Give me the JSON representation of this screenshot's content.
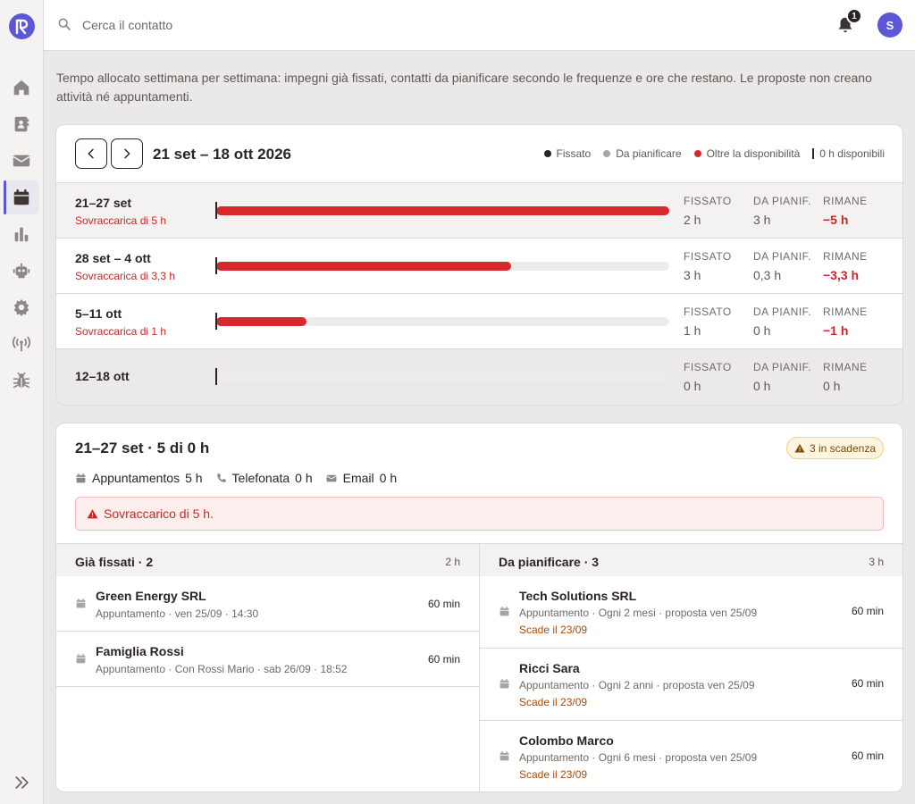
{
  "app": {
    "logo_alt": "logo"
  },
  "sidebar": {
    "items": [
      {
        "icon": "home-icon"
      },
      {
        "icon": "contacts-icon"
      },
      {
        "icon": "mail-icon"
      },
      {
        "icon": "calendar-icon"
      },
      {
        "icon": "chart-icon"
      },
      {
        "icon": "robot-icon"
      },
      {
        "icon": "gear-icon"
      },
      {
        "icon": "antenna-icon"
      },
      {
        "icon": "bug-icon"
      }
    ]
  },
  "topbar": {
    "search_placeholder": "Cerca il contatto",
    "notifications_count": "1",
    "avatar_initial": "S"
  },
  "intro": "Tempo allocato settimana per settimana: impegni già fissati, contatti da pianificare secondo le frequenze e ore che restano. Le proposte non creano attività né appuntamenti.",
  "weeks": {
    "range_title": "21 set – 18 ott 2026",
    "legend": {
      "fixed": "Fissato",
      "to_plan": "Da pianificare",
      "over": "Oltre la disponibilità",
      "available": "0 h disponibili"
    },
    "stat_labels": {
      "fixed": "FISSATO",
      "to_plan": "DA PIANIF.",
      "remaining": "RIMANE"
    },
    "rows": [
      {
        "label": "21–27 set",
        "warning": "Sovraccarica di 5 h",
        "fill": 1.0,
        "fixed": "2 h",
        "to_plan": "3 h",
        "remaining": "−5 h"
      },
      {
        "label": "28 set – 4 ott",
        "warning": "Sovraccarica di 3,3 h",
        "fill": 0.65,
        "fixed": "3 h",
        "to_plan": "0,3 h",
        "remaining": "−3,3 h"
      },
      {
        "label": "5–11 ott",
        "warning": "Sovraccarica di 1 h",
        "fill": 0.2,
        "fixed": "1 h",
        "to_plan": "0 h",
        "remaining": "−1 h"
      },
      {
        "label": "12–18 ott",
        "warning": "",
        "fill": 0.0,
        "fixed": "0 h",
        "to_plan": "0 h",
        "remaining": "0 h"
      }
    ]
  },
  "detail": {
    "title": "21–27 set · 5 di 0 h",
    "badge": "3 in scadenza",
    "types": [
      {
        "icon": "calendar-icon",
        "label": "Appuntamentos",
        "value": "5 h"
      },
      {
        "icon": "phone-icon",
        "label": "Telefonata",
        "value": "0 h"
      },
      {
        "icon": "mail-icon",
        "label": "Email",
        "value": "0 h"
      }
    ],
    "alert": "Sovraccarico di 5 h.",
    "fixed": {
      "title": "Già fissati · 2",
      "hours": "2 h",
      "items": [
        {
          "name": "Green Energy SRL",
          "sub": "Appuntamento · ven 25/09 · 14:30",
          "duration": "60 min"
        },
        {
          "name": "Famiglia Rossi",
          "sub": "Appuntamento · Con Rossi Mario · sab 26/09 · 18:52",
          "duration": "60 min"
        }
      ]
    },
    "to_plan": {
      "title": "Da pianificare · 3",
      "hours": "3 h",
      "items": [
        {
          "name": "Tech Solutions SRL",
          "sub": "Appuntamento · Ogni 2 mesi · proposta ven 25/09",
          "due": "Scade il 23/09",
          "duration": "60 min"
        },
        {
          "name": "Ricci Sara",
          "sub": "Appuntamento · Ogni 2 anni · proposta ven 25/09",
          "due": "Scade il 23/09",
          "duration": "60 min"
        },
        {
          "name": "Colombo Marco",
          "sub": "Appuntamento · Ogni 6 mesi · proposta ven 25/09",
          "due": "Scade il 23/09",
          "duration": "60 min"
        }
      ]
    }
  },
  "colors": {
    "accent": "#5b57d6",
    "over": "#d7282b",
    "fixed": "#2a2522",
    "to_plan": "#a8a4a0"
  }
}
